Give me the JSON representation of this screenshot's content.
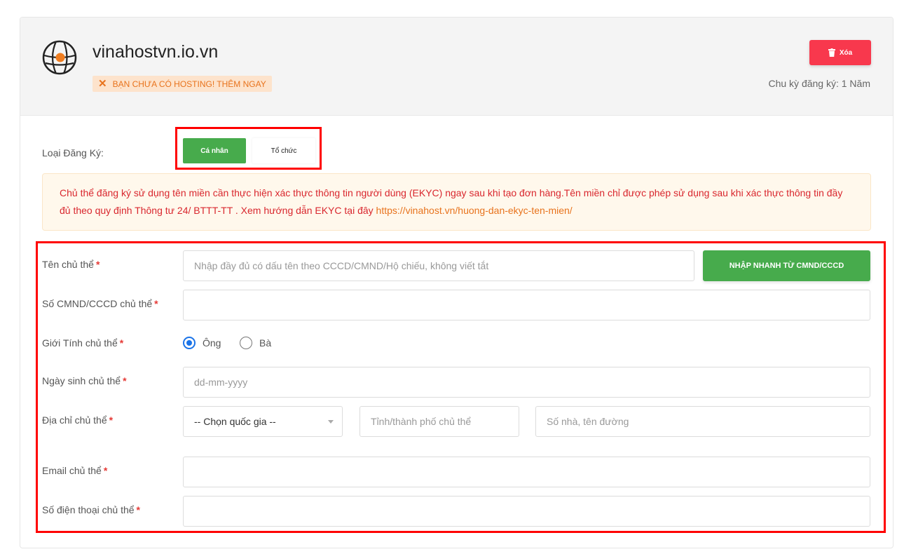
{
  "header": {
    "domain": "vinahostvn.io.vn",
    "no_hosting": "BẠN CHƯA CÓ HOSTING! THÊM NGAY",
    "delete_label": "Xóa",
    "cycle": "Chu kỳ đăng ký: 1 Năm",
    "icons": {
      "domain": "globe-icon",
      "no_hosting": "close-icon",
      "delete": "trash-icon"
    }
  },
  "registration_type": {
    "label": "Loại Đăng Ký:",
    "options": [
      "Cá nhân",
      "Tổ chức"
    ],
    "selected": "Cá nhân"
  },
  "notice": {
    "text": "Chủ thể đăng ký sử dụng tên miền cần thực hiện xác thực thông tin người dùng (EKYC) ngay sau khi tạo đơn hàng.Tên miền chỉ được phép sử dụng sau khi xác thực thông tin đầy đủ theo quy định Thông tư 24/ BTTT-TT . Xem hướng dẫn EKYC tại đây ",
    "link": "https://vinahost.vn/huong-dan-ekyc-ten-mien/"
  },
  "form": {
    "required_mark": "*",
    "name": {
      "label": "Tên chủ thể",
      "placeholder": "Nhập đầy đủ có dấu tên theo CCCD/CMND/Hộ chiếu, không viết tắt",
      "value": ""
    },
    "quick_fill": "NHẬP NHANH TỪ CMND/CCCD",
    "id_number": {
      "label": "Số CMND/CCCD chủ thể",
      "value": ""
    },
    "gender": {
      "label": "Giới Tính chủ thể",
      "options": [
        "Ông",
        "Bà"
      ],
      "selected": "Ông"
    },
    "dob": {
      "label": "Ngày sinh chủ thể",
      "placeholder": "dd-mm-yyyy",
      "value": ""
    },
    "address": {
      "label": "Địa chỉ chủ thể",
      "country": "-- Chọn quốc gia --",
      "city_placeholder": "Tỉnh/thành phố chủ thể",
      "street_placeholder": "Số nhà, tên đường"
    },
    "email": {
      "label": "Email chủ thể",
      "value": ""
    },
    "phone": {
      "label": "Số điện thoại chủ thể",
      "value": ""
    }
  },
  "colors": {
    "primary_green": "#47ab4c",
    "danger_red": "#f8384d",
    "highlight": "#ff0000",
    "accent_orange": "#e8731d"
  }
}
